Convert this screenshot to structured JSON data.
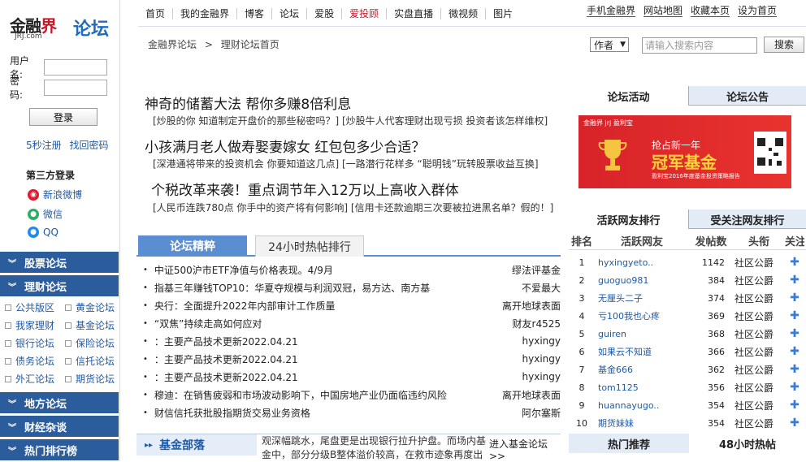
{
  "logo": {
    "brand": "金融界",
    "brand_accent": "界",
    "domain": "JRJ.com",
    "forum": "论坛"
  },
  "login": {
    "username_label": "用户名:",
    "password_label": "密　码:",
    "login_button": "登录",
    "register": "5秒注册",
    "recover": "找回密码"
  },
  "third_party": {
    "title": "第三方登录",
    "items": [
      {
        "label": "新浪微博",
        "color": "#e6162d"
      },
      {
        "label": "微信",
        "color": "#2aae67"
      },
      {
        "label": "QQ",
        "color": "#1f8ceb"
      }
    ]
  },
  "sidebar_sections": [
    "股票论坛",
    "理财论坛",
    "地方论坛",
    "财经杂谈",
    "热门排行榜"
  ],
  "sub_forums": [
    [
      "公共版区",
      "黄金论坛"
    ],
    [
      "我家理财",
      "基金论坛"
    ],
    [
      "银行论坛",
      "保险论坛"
    ],
    [
      "债务论坛",
      "信托论坛"
    ],
    [
      "外汇论坛",
      "期货论坛"
    ]
  ],
  "nav": {
    "items": [
      "首页",
      "我的金融界",
      "博客",
      "论坛",
      "爱股",
      "爱投顾",
      "实盘直播",
      "微视频",
      "图片"
    ],
    "highlight": "爱投顾",
    "highlight_color": "#c6182a",
    "right_links": [
      "手机金融界",
      "网站地图",
      "收藏本页",
      "设为首页"
    ]
  },
  "breadcrumb": {
    "root": "金融界论坛",
    "sep": ">",
    "current": "理财论坛首页"
  },
  "search": {
    "scope": "作者",
    "placeholder": "请输入搜索内容",
    "button": "搜索"
  },
  "headlines": [
    {
      "title": "神奇的储蓄大法  帮你多赚8倍利息",
      "sub": "[炒股的你 知道制定开盘价的那些秘密吗？] [炒股牛人代客理财出现亏损 投资者该怎样维权]"
    },
    {
      "title": "小孩满月老人做寿娶妻嫁女  红包包多少合适？",
      "sub": "[深港通将带来的投资机会 你要知道这几点] [一路潜行花样多 “聪明钱”玩转股票收益互换]"
    },
    {
      "title": "个税改革来袭！重点调节年入12万以上高收入群体",
      "sub": "[人民币连跌780点 你手中的资产将有何影响] [信用卡还款逾期三次要被拉进黑名单？假的！]"
    }
  ],
  "tabs": {
    "active": "论坛精粹",
    "other": "24小时热帖排行"
  },
  "posts": [
    {
      "title": "中证500沪市ETF净值与价格表现。4/9月",
      "author": "缪法评基金"
    },
    {
      "title": "指基三年赚钱TOP10：华夏夺规模与利润双冠，易方达、南方基",
      "author": "不爱最大"
    },
    {
      "title": "央行：全面提升2022年内部审计工作质量",
      "author": "离开地球表面"
    },
    {
      "title": "“双焦”持续走高如何应对",
      "author": "财友r4525"
    },
    {
      "title": "：主要产品技术更新2022.04.21",
      "author": "hyxingy"
    },
    {
      "title": "：主要产品技术更新2022.04.21",
      "author": "hyxingy"
    },
    {
      "title": "：主要产品技术更新2022.04.21",
      "author": "hyxingy"
    },
    {
      "title": "穆迪：在销售疲弱和市场波动影响下，中国房地产业仍面临违约风险",
      "author": "离开地球表面"
    },
    {
      "title": "财信信托获批股指期货交易业务资格",
      "author": "阿尔塞斯"
    }
  ],
  "fund": {
    "head": "基金部落",
    "text": "观深幅跳水，尾盘更是出现银行拉升护盘。而场内基金中，部分分级B整体溢价较高，在救市迹象再度出",
    "link": "进入基金论坛>>"
  },
  "right_tabs": {
    "active": "论坛活动",
    "other": "论坛公告"
  },
  "banner": {
    "brand": "金融界 jrj 盈利宝",
    "line1": "抢占新一年",
    "line2": "冠军基金",
    "note": "盈利宝2016年度基金投资策略报告"
  },
  "rank_tabs": {
    "active": "活跃网友排行",
    "other": "受关注网友排行"
  },
  "rank_headers": [
    "排名",
    "活跃网友",
    "发帖数",
    "头衔",
    "关注"
  ],
  "rank_rows": [
    {
      "rank": "1",
      "name": "hyxingyeto..",
      "posts": "1142",
      "title": "社区公爵"
    },
    {
      "rank": "2",
      "name": "guoguo981",
      "posts": "384",
      "title": "社区公爵"
    },
    {
      "rank": "3",
      "name": "无厘头二子",
      "posts": "374",
      "title": "社区公爵"
    },
    {
      "rank": "4",
      "name": "亏100我也心疼",
      "posts": "369",
      "title": "社区公爵"
    },
    {
      "rank": "5",
      "name": "guiren",
      "posts": "368",
      "title": "社区公爵"
    },
    {
      "rank": "6",
      "name": "如果云不知道",
      "posts": "366",
      "title": "社区公爵"
    },
    {
      "rank": "7",
      "name": "基金666",
      "posts": "362",
      "title": "社区公爵"
    },
    {
      "rank": "8",
      "name": "tom1125",
      "posts": "356",
      "title": "社区公爵"
    },
    {
      "rank": "9",
      "name": "huannayugo..",
      "posts": "354",
      "title": "社区公爵"
    },
    {
      "rank": "10",
      "name": "期货妹妹",
      "posts": "354",
      "title": "社区公爵"
    }
  ],
  "bottom_tabs": {
    "active": "热门推荐",
    "other": "48小时热帖"
  }
}
